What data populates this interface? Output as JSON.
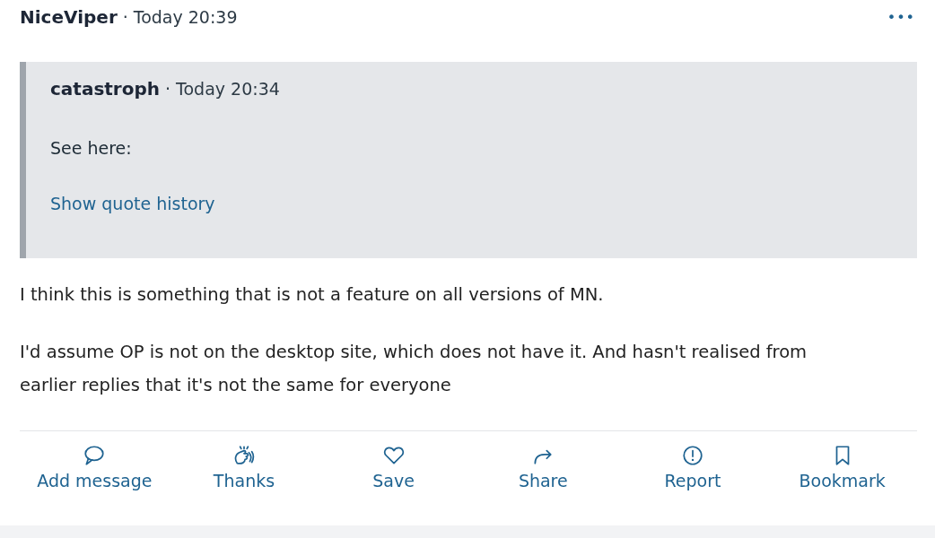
{
  "post": {
    "author": "NiceViper",
    "separator": "·",
    "time": "Today 20:39",
    "menu": "•••",
    "quote": {
      "author": "catastroph",
      "separator": "·",
      "time": "Today 20:34",
      "text": "See here:",
      "link": "Show quote history"
    },
    "paragraphs": [
      "I think this is something that is not a feature on all versions of MN.",
      "I'd assume OP is not on the desktop site, which does not have it. And hasn't realised from earlier replies that it's not the same for everyone"
    ],
    "actions": [
      {
        "kind": "message",
        "label": "Add message"
      },
      {
        "kind": "thanks",
        "label": "Thanks"
      },
      {
        "kind": "save",
        "label": "Save"
      },
      {
        "kind": "share",
        "label": "Share"
      },
      {
        "kind": "report",
        "label": "Report"
      },
      {
        "kind": "bookmark",
        "label": "Bookmark"
      }
    ]
  }
}
